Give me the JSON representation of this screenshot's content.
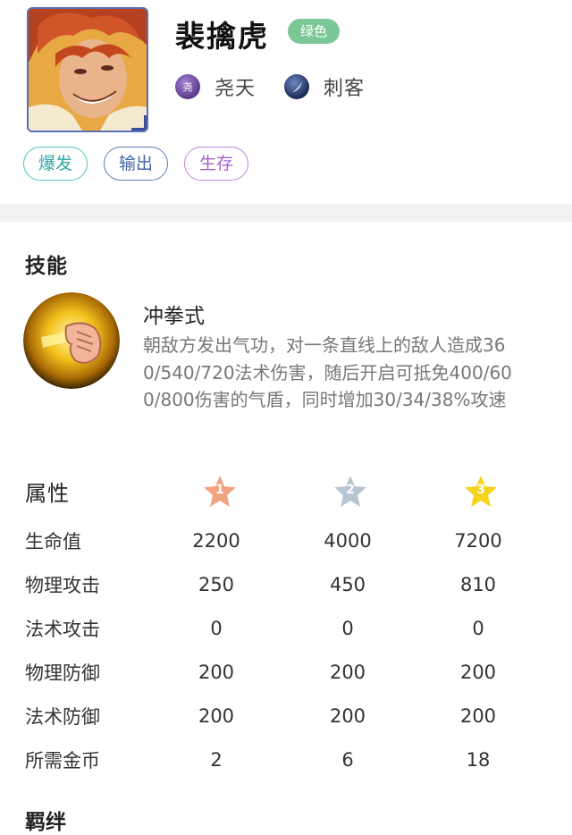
{
  "hero": {
    "name": "裴擒虎",
    "rarity": "绿色",
    "faction": {
      "icon": "faction-yaotian-icon",
      "icon_char": "尧",
      "label": "尧天"
    },
    "role": {
      "icon": "assassin-role-icon",
      "label": "刺客"
    },
    "tags": [
      "爆发",
      "输出",
      "生存"
    ]
  },
  "skills": {
    "title": "技能",
    "name": "冲拳式",
    "description": "朝敌方发出气功，对一条直线上的敌人造成360/540/720法术伤害，随后开启可抵免400/600/800伤害的气盾，同时增加30/34/38%攻速"
  },
  "attributes": {
    "title": "属性",
    "stars": [
      "1",
      "2",
      "3"
    ],
    "rows": [
      {
        "label": "生命值",
        "values": [
          "2200",
          "4000",
          "7200"
        ]
      },
      {
        "label": "物理攻击",
        "values": [
          "250",
          "450",
          "810"
        ]
      },
      {
        "label": "法术攻击",
        "values": [
          "0",
          "0",
          "0"
        ]
      },
      {
        "label": "物理防御",
        "values": [
          "200",
          "200",
          "200"
        ]
      },
      {
        "label": "法术防御",
        "values": [
          "200",
          "200",
          "200"
        ]
      },
      {
        "label": "所需金币",
        "values": [
          "2",
          "6",
          "18"
        ]
      }
    ]
  },
  "next_section": {
    "title": "羁绊"
  },
  "colors": {
    "rarity_green": "#7cc796",
    "tag_burst": "#2fa7a5",
    "tag_output": "#4263a7",
    "tag_survive": "#a860c8",
    "star_bronze": "#f0a37f",
    "star_silver": "#b9c4d2",
    "star_gold": "#f5d31d"
  }
}
